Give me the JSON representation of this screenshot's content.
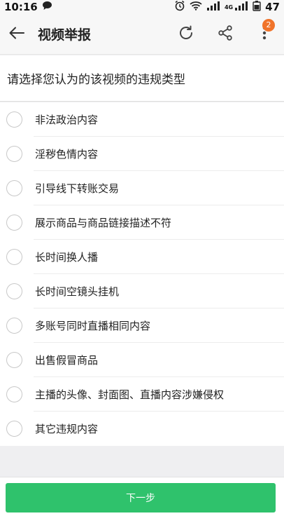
{
  "status_bar": {
    "time": "10:16",
    "battery": "47",
    "network": "4G"
  },
  "header": {
    "title": "视频举报",
    "badge_count": "2"
  },
  "prompt": "请选择您认为的该视频的违规类型",
  "options": [
    {
      "label": "非法政治内容"
    },
    {
      "label": "淫秽色情内容"
    },
    {
      "label": "引导线下转账交易"
    },
    {
      "label": "展示商品与商品链接描述不符"
    },
    {
      "label": "长时间换人播"
    },
    {
      "label": "长时间空镜头挂机"
    },
    {
      "label": "多账号同时直播相同内容"
    },
    {
      "label": "出售假冒商品"
    },
    {
      "label": "主播的头像、封面图、直播内容涉嫌侵权"
    },
    {
      "label": "其它违规内容"
    }
  ],
  "footer": {
    "next_label": "下一步"
  },
  "colors": {
    "accent": "#2fc26c",
    "badge": "#f0732a"
  },
  "icons": [
    "chat-icon",
    "alarm-icon",
    "wifi-icon",
    "signal-icon",
    "back-arrow-icon",
    "refresh-icon",
    "share-icon",
    "more-icon"
  ]
}
